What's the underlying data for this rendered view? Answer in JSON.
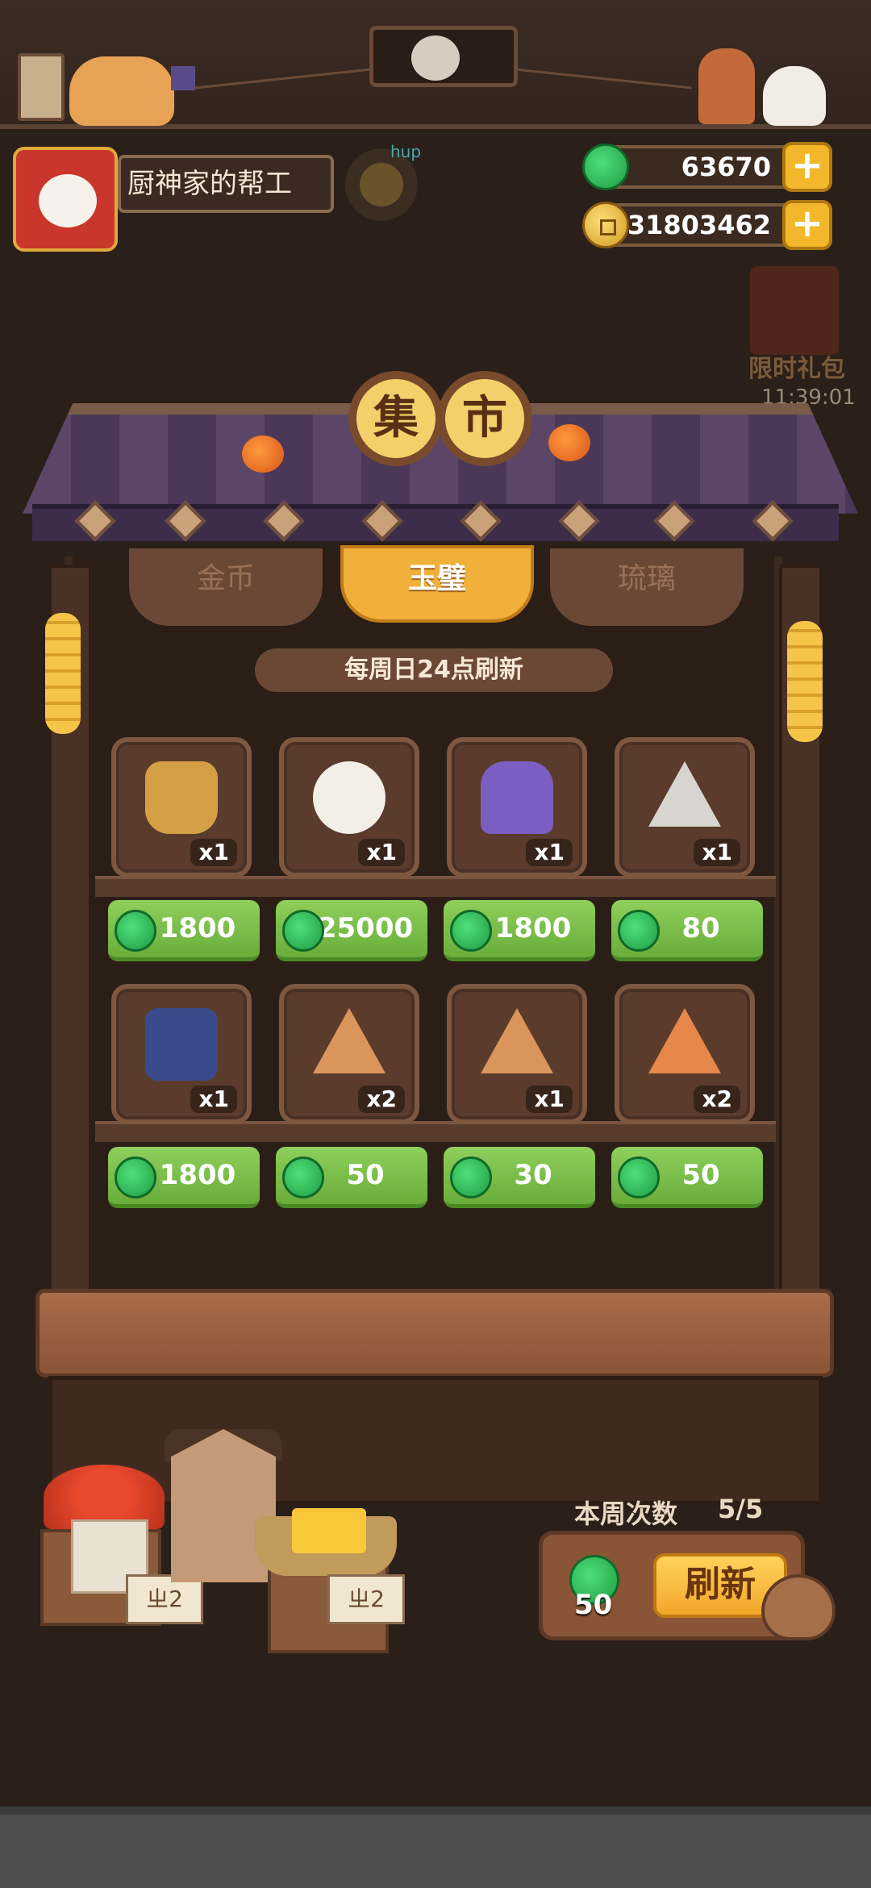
{
  "player": {
    "title": "厨神家的帮工",
    "hup_label": "hup"
  },
  "currency": {
    "jade": "63670",
    "coins": "31803462",
    "plus": "+"
  },
  "event": {
    "label": "限时礼包",
    "timer": "11:39:01"
  },
  "market": {
    "title_chars": [
      "集",
      "市"
    ],
    "tabs": [
      {
        "label": "金币",
        "active": false
      },
      {
        "label": "玉璧",
        "active": true
      },
      {
        "label": "琉璃",
        "active": false
      }
    ],
    "refresh_note": "每周日24点刷新",
    "items": [
      {
        "icon": "basket-item",
        "qty": "x1",
        "price": "1800"
      },
      {
        "icon": "bear-musician-item",
        "qty": "x1",
        "price": "25000"
      },
      {
        "icon": "purple-lantern-item",
        "qty": "x1",
        "price": "1800"
      },
      {
        "icon": "silver-rice-ball-item",
        "qty": "x1",
        "price": "80"
      },
      {
        "icon": "blue-jar-item",
        "qty": "x1",
        "price": "1800"
      },
      {
        "icon": "brown-rice-ball-item",
        "qty": "x2",
        "price": "50"
      },
      {
        "icon": "brown-rice-ball-item",
        "qty": "x1",
        "price": "30"
      },
      {
        "icon": "orange-rice-ball-item",
        "qty": "x2",
        "price": "50"
      }
    ]
  },
  "stall_signs": [
    "ㄓ2",
    "ㄓ2"
  ],
  "weekly": {
    "label": "本周次数",
    "value": "5/5"
  },
  "refresh": {
    "cost": "50",
    "button": "刷新"
  },
  "colors": {
    "price_green": "#7cbf4a",
    "tab_active": "#f0b03a",
    "background": "#2a1f19"
  }
}
